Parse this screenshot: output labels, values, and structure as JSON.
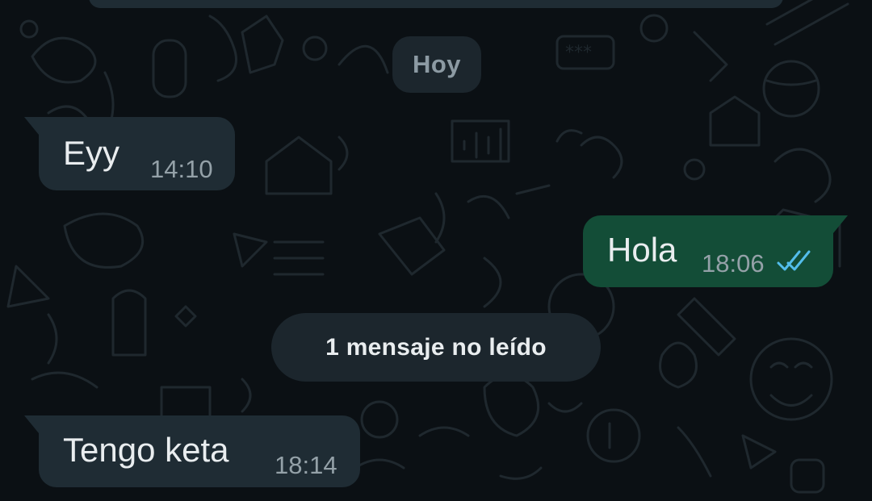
{
  "colors": {
    "background": "#0b1014",
    "incoming_bubble": "#1f2c34",
    "outgoing_bubble": "#134d37",
    "read_ticks": "#53bdeb",
    "text": "#e9edef",
    "time_text": "#94a1a8"
  },
  "date_chip": {
    "label": "Hoy"
  },
  "unread_banner": {
    "label": "1 mensaje no leído"
  },
  "messages": [
    {
      "direction": "incoming",
      "text": "Eyy",
      "time": "14:10"
    },
    {
      "direction": "outgoing",
      "text": "Hola",
      "time": "18:06",
      "status_icon": "double-check-read-icon"
    },
    {
      "direction": "incoming",
      "text": "Tengo keta",
      "time": "18:14"
    }
  ]
}
